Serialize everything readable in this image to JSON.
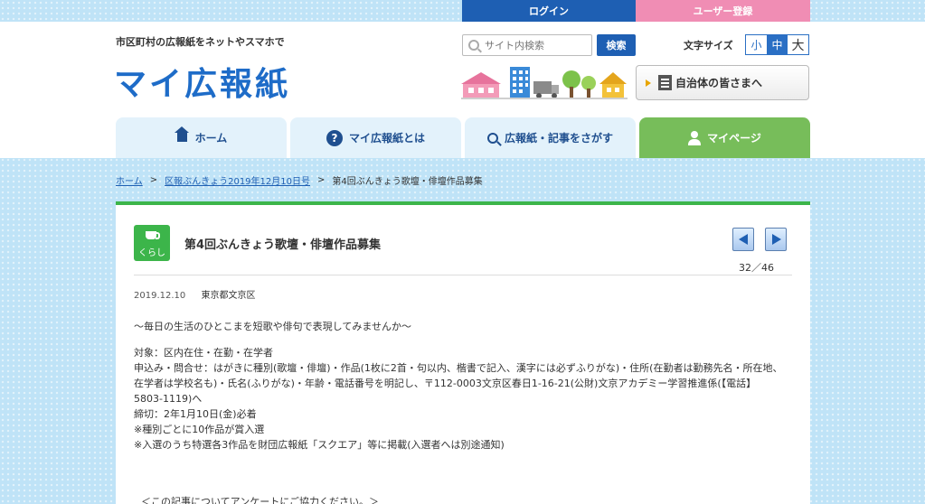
{
  "topbar": {
    "login": "ログイン",
    "register": "ユーザー登録"
  },
  "header": {
    "tagline": "市区町村の広報紙をネットやスマホで",
    "logo": "マイ広報紙",
    "search_placeholder": "サイト内検索",
    "search_button": "検索",
    "fontsize_label": "文字サイズ",
    "fontsize_small": "小",
    "fontsize_medium": "中",
    "fontsize_large": "大",
    "municipal_button": "自治体の皆さまへ"
  },
  "nav": {
    "home": "ホーム",
    "about": "マイ広報紙とは",
    "search": "広報紙・記事をさがす",
    "mypage": "マイページ"
  },
  "breadcrumb": {
    "home": "ホーム",
    "sep": ">",
    "issue": "区報ぶんきょう2019年12月10日号",
    "current": "第4回ぶんきょう歌壇・俳壇作品募集"
  },
  "article": {
    "category": "くらし",
    "title": "第4回ぶんきょう歌壇・俳壇作品募集",
    "pager": "32／46",
    "date": "2019.12.10",
    "org": "東京都文京区",
    "lead": "〜毎日の生活のひとこまを短歌や俳句で表現してみませんか〜",
    "lines": [
      "対象：区内在住・在勤・在学者",
      "申込み・問合せ：はがきに種別(歌壇・俳壇)・作品(1枚に2首・句以内、楷書で記入、漢字には必ずふりがな)・住所(在勤者は勤務先名・所在地、在学者は学校名も)・氏名(ふりがな)・年齢・電話番号を明記し、〒112-0003文京区春日1-16-21(公財)文京アカデミー学習推進係(【電話】5803-1119)へ",
      "締切：2年1月10日(金)必着",
      "※種別ごとに10作品が賞入選",
      "※入選のうち特選各3作品を財団広報紙「スクエア」等に掲載(入選者へは別途通知)"
    ],
    "survey": "＜この記事についてアンケートにご協力ください。＞"
  },
  "colors": {
    "brand_blue": "#1e6cc8",
    "accent_green": "#3cb54a",
    "pink": "#f08db4",
    "nav_active": "#77bd5a"
  }
}
